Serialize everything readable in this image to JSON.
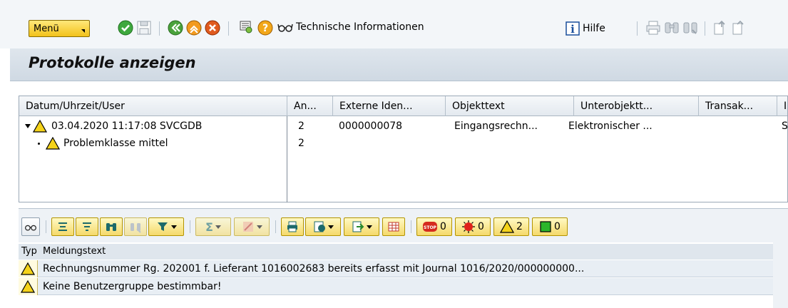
{
  "toolbar": {
    "menu_label": "Menü",
    "tech_info_label": "Technische Informationen",
    "help_label": "Hilfe"
  },
  "page": {
    "title": "Protokolle anzeigen"
  },
  "upper_table": {
    "headers": [
      "Datum/Uhrzeit/User",
      "An...",
      "Externe Iden...",
      "Objekttext",
      "Unterobjektt...",
      "Transak...",
      "I"
    ],
    "rows": [
      {
        "label": "03.04.2020  11:17:08  SVCGDB",
        "count": "2",
        "ext_id": "0000000078",
        "objtext": "Eingangsrechn...",
        "subobj": "Elektronischer ...",
        "trans": "",
        "extra": "S"
      },
      {
        "label": "Problemklasse mittel",
        "count": "2",
        "ext_id": "",
        "objtext": "",
        "subobj": "",
        "trans": "",
        "extra": ""
      }
    ]
  },
  "log_toolbar": {
    "stop_count": "0",
    "error_count": "0",
    "warning_count": "2",
    "ok_count": "0"
  },
  "log_table": {
    "headers": [
      "Typ",
      "Meldungstext"
    ],
    "rows": [
      {
        "text": "Rechnungsnummer Rg. 202001 f. Lieferant 1016002683 bereits erfasst mit Journal 1016/2020/000000000..."
      },
      {
        "text": "Keine Benutzergruppe bestimmbar!"
      }
    ]
  },
  "colors": {
    "warning": "#f5d31a",
    "accent": "#f2c21b",
    "stop": "#d52b1e",
    "ok": "#2bb52b"
  }
}
